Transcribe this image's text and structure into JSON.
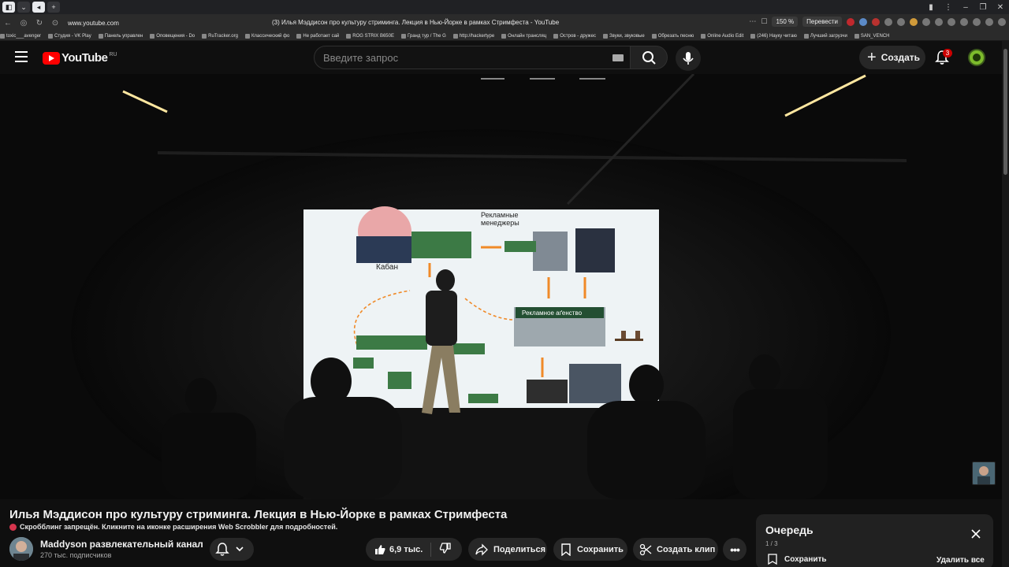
{
  "browser": {
    "url": "www.youtube.com",
    "page_title": "(3) Илья Мэддисон про культуру стриминга. Лекция в Нью-Йорке в рамках Стримфеста - YouTube",
    "zoom": "150 %",
    "translate_label": "Перевести",
    "bookmarks": [
      "toxic___avenger",
      "Студия - VK Play",
      "Панель управлен",
      "Оповещения - Do",
      "RuTracker.org",
      "Классический фо",
      "Не работает сай",
      "ROG STRIX B650E",
      "Гранд тур / The G",
      "http://hackertype",
      "Онлайн трансляц",
      "Остров - дружес",
      "Звуки, звуковые",
      "Обрезать песню",
      "Online Audio Edit",
      "(246) Науку читаю",
      "Лучший загрузчи",
      "SAN_VENCH"
    ]
  },
  "header": {
    "logo_text": "YouTube",
    "region": "RU",
    "search_placeholder": "Введите запрос",
    "create_label": "Создать",
    "notifications_count": "3"
  },
  "slide": {
    "label_boar": "Кабан",
    "label_managers_1": "Рекламные",
    "label_managers_2": "менеджеры",
    "label_agency": "Рекламное аґенство"
  },
  "video": {
    "title": "Илья Мэддисон про культуру стриминга. Лекция в Нью-Йорке в рамках Стримфеста",
    "scrobbler_notice": "Скробблинг запрещён. Кликните на иконке расширения Web Scrobbler для подробностей.",
    "channel_name": "Maddyson развлекательный канал",
    "subscribers": "270 тыс. подписчиков",
    "likes": "6,9 тыс.",
    "share_label": "Поделиться",
    "save_label": "Сохранить",
    "clip_label": "Создать клип"
  },
  "queue": {
    "title": "Очередь",
    "counter": "1 / 3",
    "save_label": "Сохранить",
    "delete_all_label": "Удалить все"
  }
}
